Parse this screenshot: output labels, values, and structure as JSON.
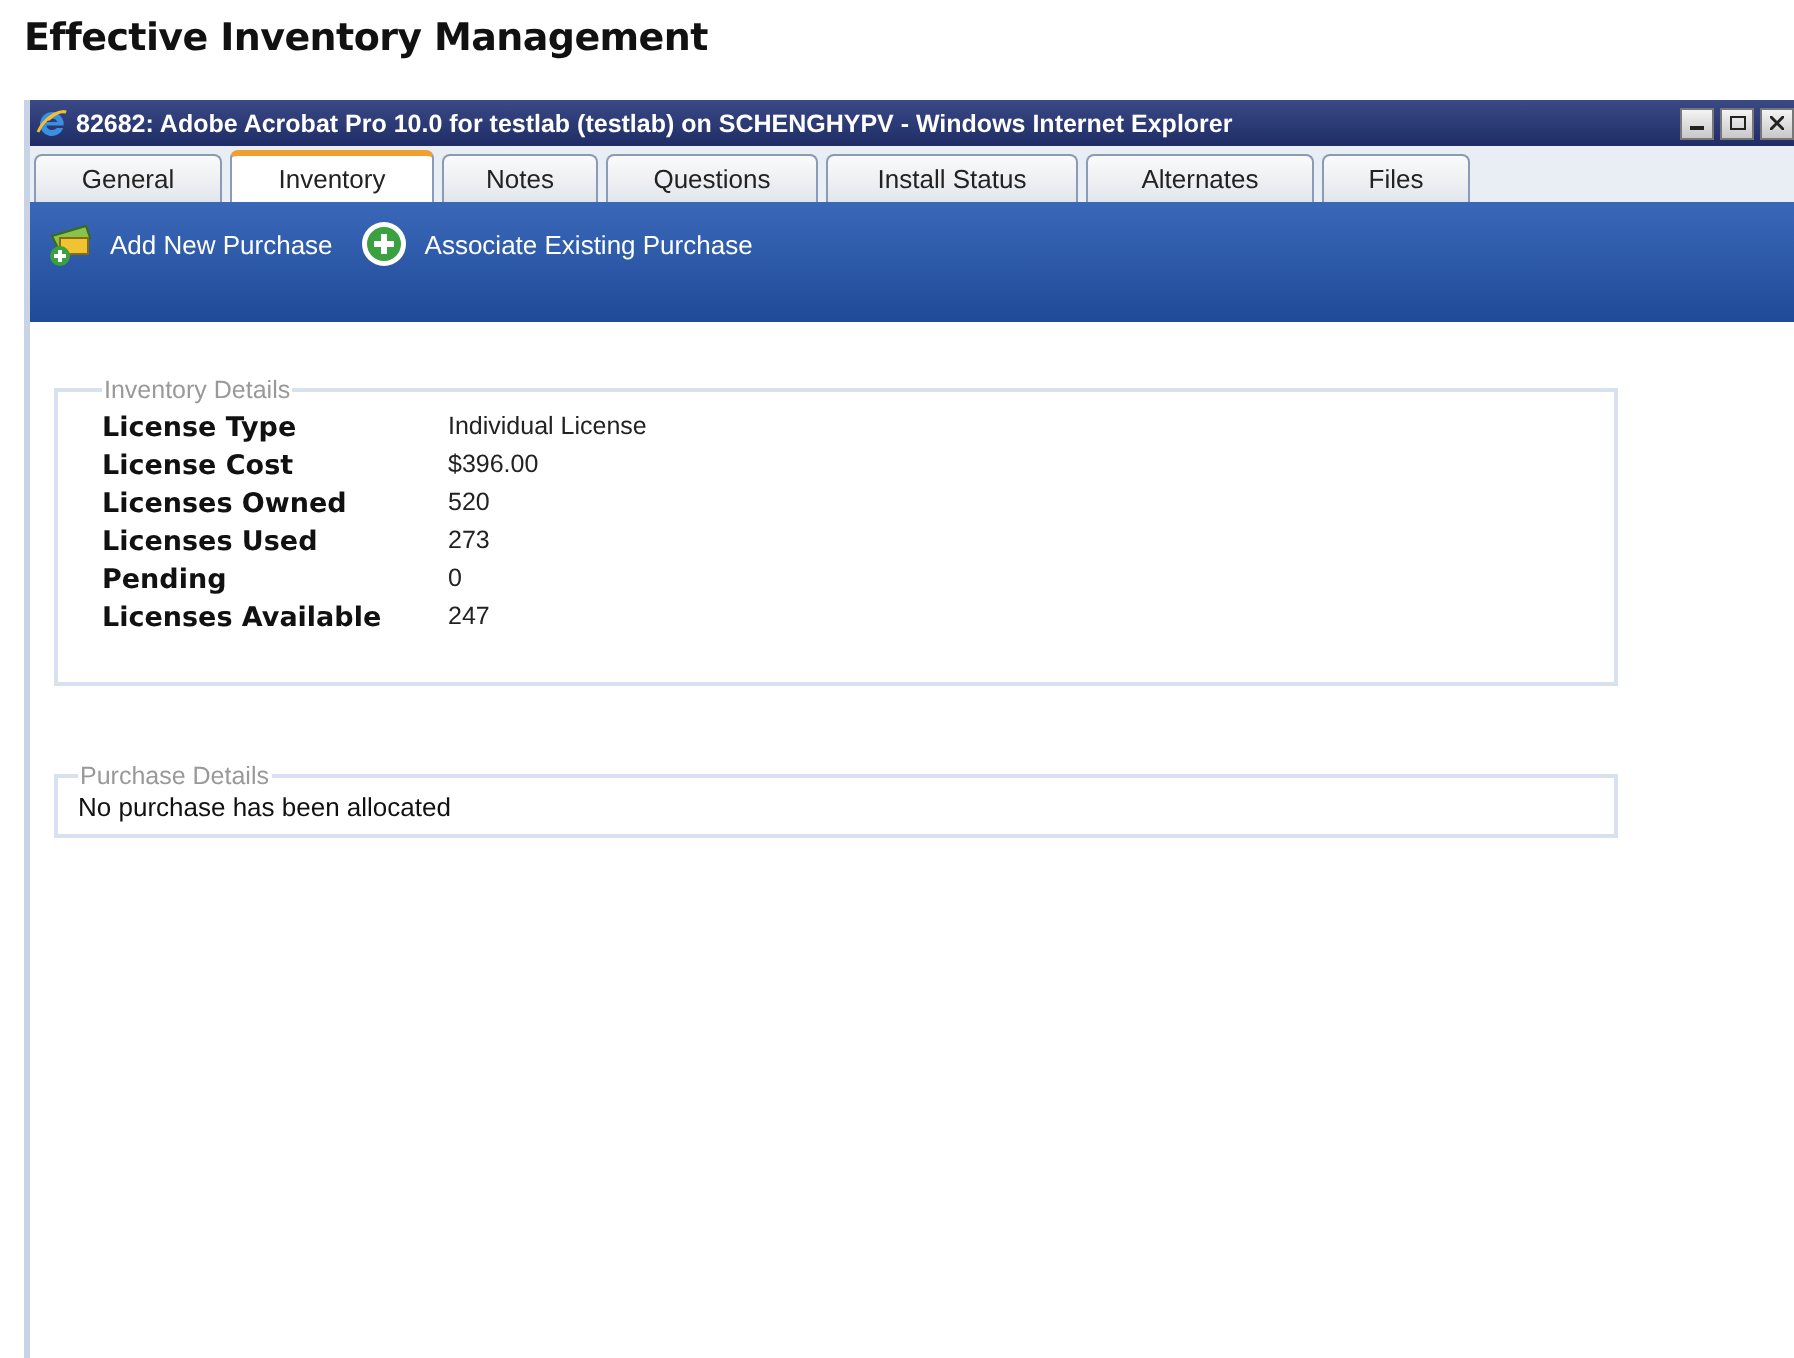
{
  "heading": "Effective Inventory Management",
  "window": {
    "title": "82682: Adobe Acrobat Pro 10.0 for testlab (testlab) on SCHENGHYPV - Windows Internet Explorer"
  },
  "tabs": [
    {
      "label": "General",
      "selected": false
    },
    {
      "label": "Inventory",
      "selected": true
    },
    {
      "label": "Notes",
      "selected": false
    },
    {
      "label": "Questions",
      "selected": false
    },
    {
      "label": "Install Status",
      "selected": false
    },
    {
      "label": "Alternates",
      "selected": false
    },
    {
      "label": "Files",
      "selected": false
    }
  ],
  "toolbar": [
    {
      "kind": "add",
      "label": "Add New Purchase"
    },
    {
      "kind": "associate",
      "label": "Associate Existing Purchase"
    }
  ],
  "inventory_details": {
    "title": "Inventory Details",
    "rows": [
      {
        "label": "License Type",
        "value": "Individual License"
      },
      {
        "label": "License Cost",
        "value": "$396.00"
      },
      {
        "label": "Licenses Owned",
        "value": "520"
      },
      {
        "label": "Licenses Used",
        "value": "273"
      },
      {
        "label": "Pending",
        "value": "0"
      },
      {
        "label": "Licenses Available",
        "value": "247"
      }
    ]
  },
  "purchase_details": {
    "title": "Purchase Details",
    "message": "No purchase has been allocated"
  }
}
